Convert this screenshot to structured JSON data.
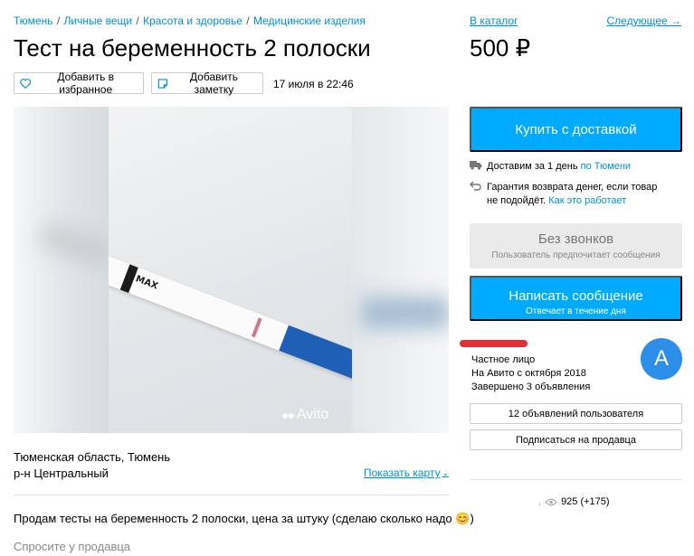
{
  "breadcrumbs": [
    "Тюмень",
    "Личные вещи",
    "Красота и здоровье",
    "Медицинские изделия"
  ],
  "catalog_link": "В каталог",
  "next_link": "Следующее →",
  "title": "Тест на беременность 2 полоски",
  "price": "500 ₽",
  "actions": {
    "favorite": "Добавить в избранное",
    "note": "Добавить заметку",
    "date": "17 июля в 22:46"
  },
  "gallery": {
    "strip_label": "MAX",
    "watermark": "Avito"
  },
  "location": {
    "region": "Тюменская область, Тюмень",
    "district": "р-н Центральный",
    "map_link": "Показать карту"
  },
  "description": "Продам тесты на беременность 2 полоски, цена за штуку (сделаю сколько надо 😊)",
  "ask_seller": "Спросите у продавца",
  "sidebar": {
    "buy_button": "Купить с доставкой",
    "delivery_text": "Доставим за 1 день",
    "delivery_link": "по Тюмени",
    "refund_text": "Гарантия возврата денег, если товар не подойдёт.",
    "refund_link": "Как это работает",
    "no_calls_title": "Без звонков",
    "no_calls_sub": "Пользователь предпочитает сообщения",
    "message_title": "Написать сообщение",
    "message_sub": "Отвечает в течение дня",
    "seller_type": "Частное лицо",
    "seller_since": "На Авито с октября 2018",
    "seller_completed": "Завершено 3 объявления",
    "avatar_letter": "A",
    "ads_button": "12 объявлений пользователя",
    "subscribe_button": "Подписаться на продавца",
    "views": "925 (+175)"
  },
  "colors": {
    "accent": "#00aaff",
    "link": "#0091d9",
    "avatar": "#2d8ee8"
  }
}
